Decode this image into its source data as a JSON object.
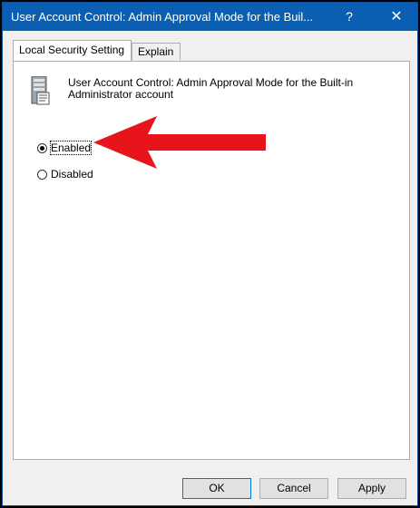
{
  "window": {
    "title": "User Account Control: Admin Approval Mode for the Buil...",
    "help_glyph": "?",
    "close_glyph": "✕"
  },
  "tabs": [
    {
      "label": "Local Security Setting",
      "active": true
    },
    {
      "label": "Explain",
      "active": false
    }
  ],
  "policy": {
    "icon": "server-policy-icon",
    "title": "User Account Control: Admin Approval Mode for the Built-in Administrator account"
  },
  "options": {
    "enabled_label": "Enabled",
    "disabled_label": "Disabled",
    "selected": "Enabled"
  },
  "annotation": {
    "arrow_color": "#e8141c"
  },
  "buttons": {
    "ok": "OK",
    "cancel": "Cancel",
    "apply": "Apply"
  }
}
